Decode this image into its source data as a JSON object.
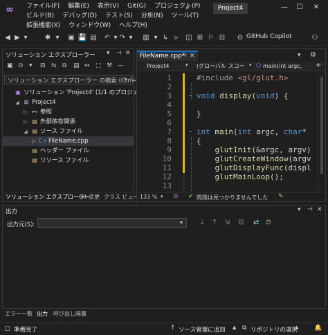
{
  "app": {
    "logo_glyph": "∞",
    "search_glyph": "⌕",
    "window_title": "Project4",
    "window_buttons": [
      "—",
      "☐",
      "✕"
    ]
  },
  "menu": {
    "row1": [
      "ファイル(F)",
      "編集(E)",
      "表示(V)",
      "Git(G)",
      "プロジェクト(P)"
    ],
    "row2": [
      "ビルド(B)",
      "デバッグ(D)",
      "テスト(S)",
      "分析(N)",
      "ツール(T)"
    ],
    "row3": [
      "拡張機能(X)",
      "ウィンドウ(W)",
      "ヘルプ(H)"
    ]
  },
  "toolbar": {
    "icons": [
      "◀",
      "▶",
      "▾",
      "✱",
      "▾",
      "▣",
      "💾",
      "▤",
      "↶",
      "▾",
      "↷",
      "▾",
      "▥",
      "▾",
      "↳",
      "▹",
      "◫",
      "⊞",
      "⚐",
      "⊟"
    ],
    "copilot_icon": "⊙",
    "copilot_label": "GitHub Copilot",
    "person_icon": "⚇"
  },
  "solution_explorer": {
    "title": "ソリューション エクスプローラー",
    "header_buttons": [
      "▾",
      "⊣",
      "✕"
    ],
    "toolbar_icons": [
      "▣",
      "⊙",
      "▾",
      "⊟",
      "⇆",
      "⧉",
      "▤",
      "↔",
      "⬚",
      "⚒",
      "—"
    ],
    "search_placeholder": "ソリューション エクスプローラー の検索 (Ctrl+;)",
    "search_icon": "⌕",
    "tree": [
      {
        "label": "ソリューション 'Project4' (1/1 のプロジェクト)",
        "indent": 0,
        "arrow": "",
        "icon": "▣",
        "icon_color": "#c586ff"
      },
      {
        "label": "Project4",
        "indent": 1,
        "arrow": "◢",
        "icon": "⊞",
        "icon_color": "#9cdcfe"
      },
      {
        "label": "参照",
        "indent": 2,
        "arrow": "▷",
        "icon": "⊷",
        "icon_color": "#d0d0d0"
      },
      {
        "label": "外部依存関係",
        "indent": 2,
        "arrow": "▷",
        "icon": "▤",
        "icon_color": "#d7ba7d"
      },
      {
        "label": "ソース ファイル",
        "indent": 2,
        "arrow": "◢",
        "icon": "▤",
        "icon_color": "#d7ba7d"
      },
      {
        "label": "FileName.cpp",
        "indent": 3,
        "arrow": "▷",
        "icon": "C+",
        "icon_color": "#569cd6",
        "selected": true
      },
      {
        "label": "ヘッダー ファイル",
        "indent": 2,
        "arrow": "",
        "icon": "▤",
        "icon_color": "#d7ba7d"
      },
      {
        "label": "リソース ファイル",
        "indent": 2,
        "arrow": "",
        "icon": "▤",
        "icon_color": "#d7ba7d"
      }
    ],
    "bottom_tabs": [
      "ソリューション エクスプローラー",
      "Git 変更",
      "クラス ビュー"
    ]
  },
  "editor": {
    "tab_label": "FileName.cpp*",
    "tab_pin": "⊣",
    "tab_close": "✕",
    "right_buttons": [
      "▾",
      "⚙"
    ],
    "nav": {
      "project": "Project4",
      "scope": "(グローバル スコー",
      "member_icon": "⬡",
      "member": "main(int argc,",
      "split_icon": "+"
    },
    "lines": [
      {
        "n": "1",
        "fold": "",
        "html": "<span class=\"pp\">#include</span> <span class=\"str\">&lt;gl/glut.h&gt;</span>"
      },
      {
        "n": "2",
        "fold": "",
        "html": ""
      },
      {
        "n": "3",
        "fold": "⌄",
        "html": "<span class=\"kw\">void</span> <span class=\"fn\">display</span>(<span class=\"kw\">void</span>) {"
      },
      {
        "n": "4",
        "fold": "",
        "html": ""
      },
      {
        "n": "5",
        "fold": "",
        "html": "}"
      },
      {
        "n": "6",
        "fold": "",
        "html": ""
      },
      {
        "n": "7",
        "fold": "⌄",
        "html": "<span class=\"kw\">int</span> <span class=\"fn\">main</span>(<span class=\"kw\">int</span> argc, <span class=\"kw\">char</span>*"
      },
      {
        "n": "8",
        "fold": "",
        "html": "{"
      },
      {
        "n": "9",
        "fold": "",
        "html": "    <span class=\"fn\">glutInit</span>(&amp;argc, argv)"
      },
      {
        "n": "10",
        "fold": "",
        "html": "    <span class=\"fn\">glutCreateWindow</span>(argv"
      },
      {
        "n": "11",
        "fold": "",
        "html": "    <span class=\"fn\">glutDisplayFunc</span>(displ"
      },
      {
        "n": "12",
        "fold": "",
        "html": "    <span class=\"fn\">glutMainLoop</span>();"
      },
      {
        "n": "13",
        "fold": "",
        "html": ""
      }
    ],
    "zoom": "133 %",
    "zoom_icon": "▾",
    "copilot_status_icon": "⊙",
    "status_ok_icon": "✔",
    "status_text": "問題は見つかりませんでした",
    "brush_icon": "✎"
  },
  "output": {
    "title": "出力",
    "header_buttons": [
      "▾",
      "⊣",
      "✕"
    ],
    "source_label": "出力元(S):",
    "source_value": "",
    "toolbar_icons": [
      "▾",
      "⇣",
      "⇡",
      "⇲",
      "⊟",
      "⇄",
      "⏲"
    ]
  },
  "bottom_tabs": [
    "エラー一覧",
    "出力",
    "呼び出し階層"
  ],
  "statusbar": {
    "ready_icon": "▢",
    "ready": "準備完了",
    "source_control_arrow": "↑",
    "source_control": "ソース管理に追加",
    "repo_icon": "⧉",
    "repo": "リポジトリの選択",
    "bell_icon": "🔔"
  },
  "colors": {
    "accent": "#0078d4",
    "keyword": "#569cd6",
    "function": "#dcdcaa",
    "string": "#ce9178",
    "success": "#4ec94e"
  }
}
